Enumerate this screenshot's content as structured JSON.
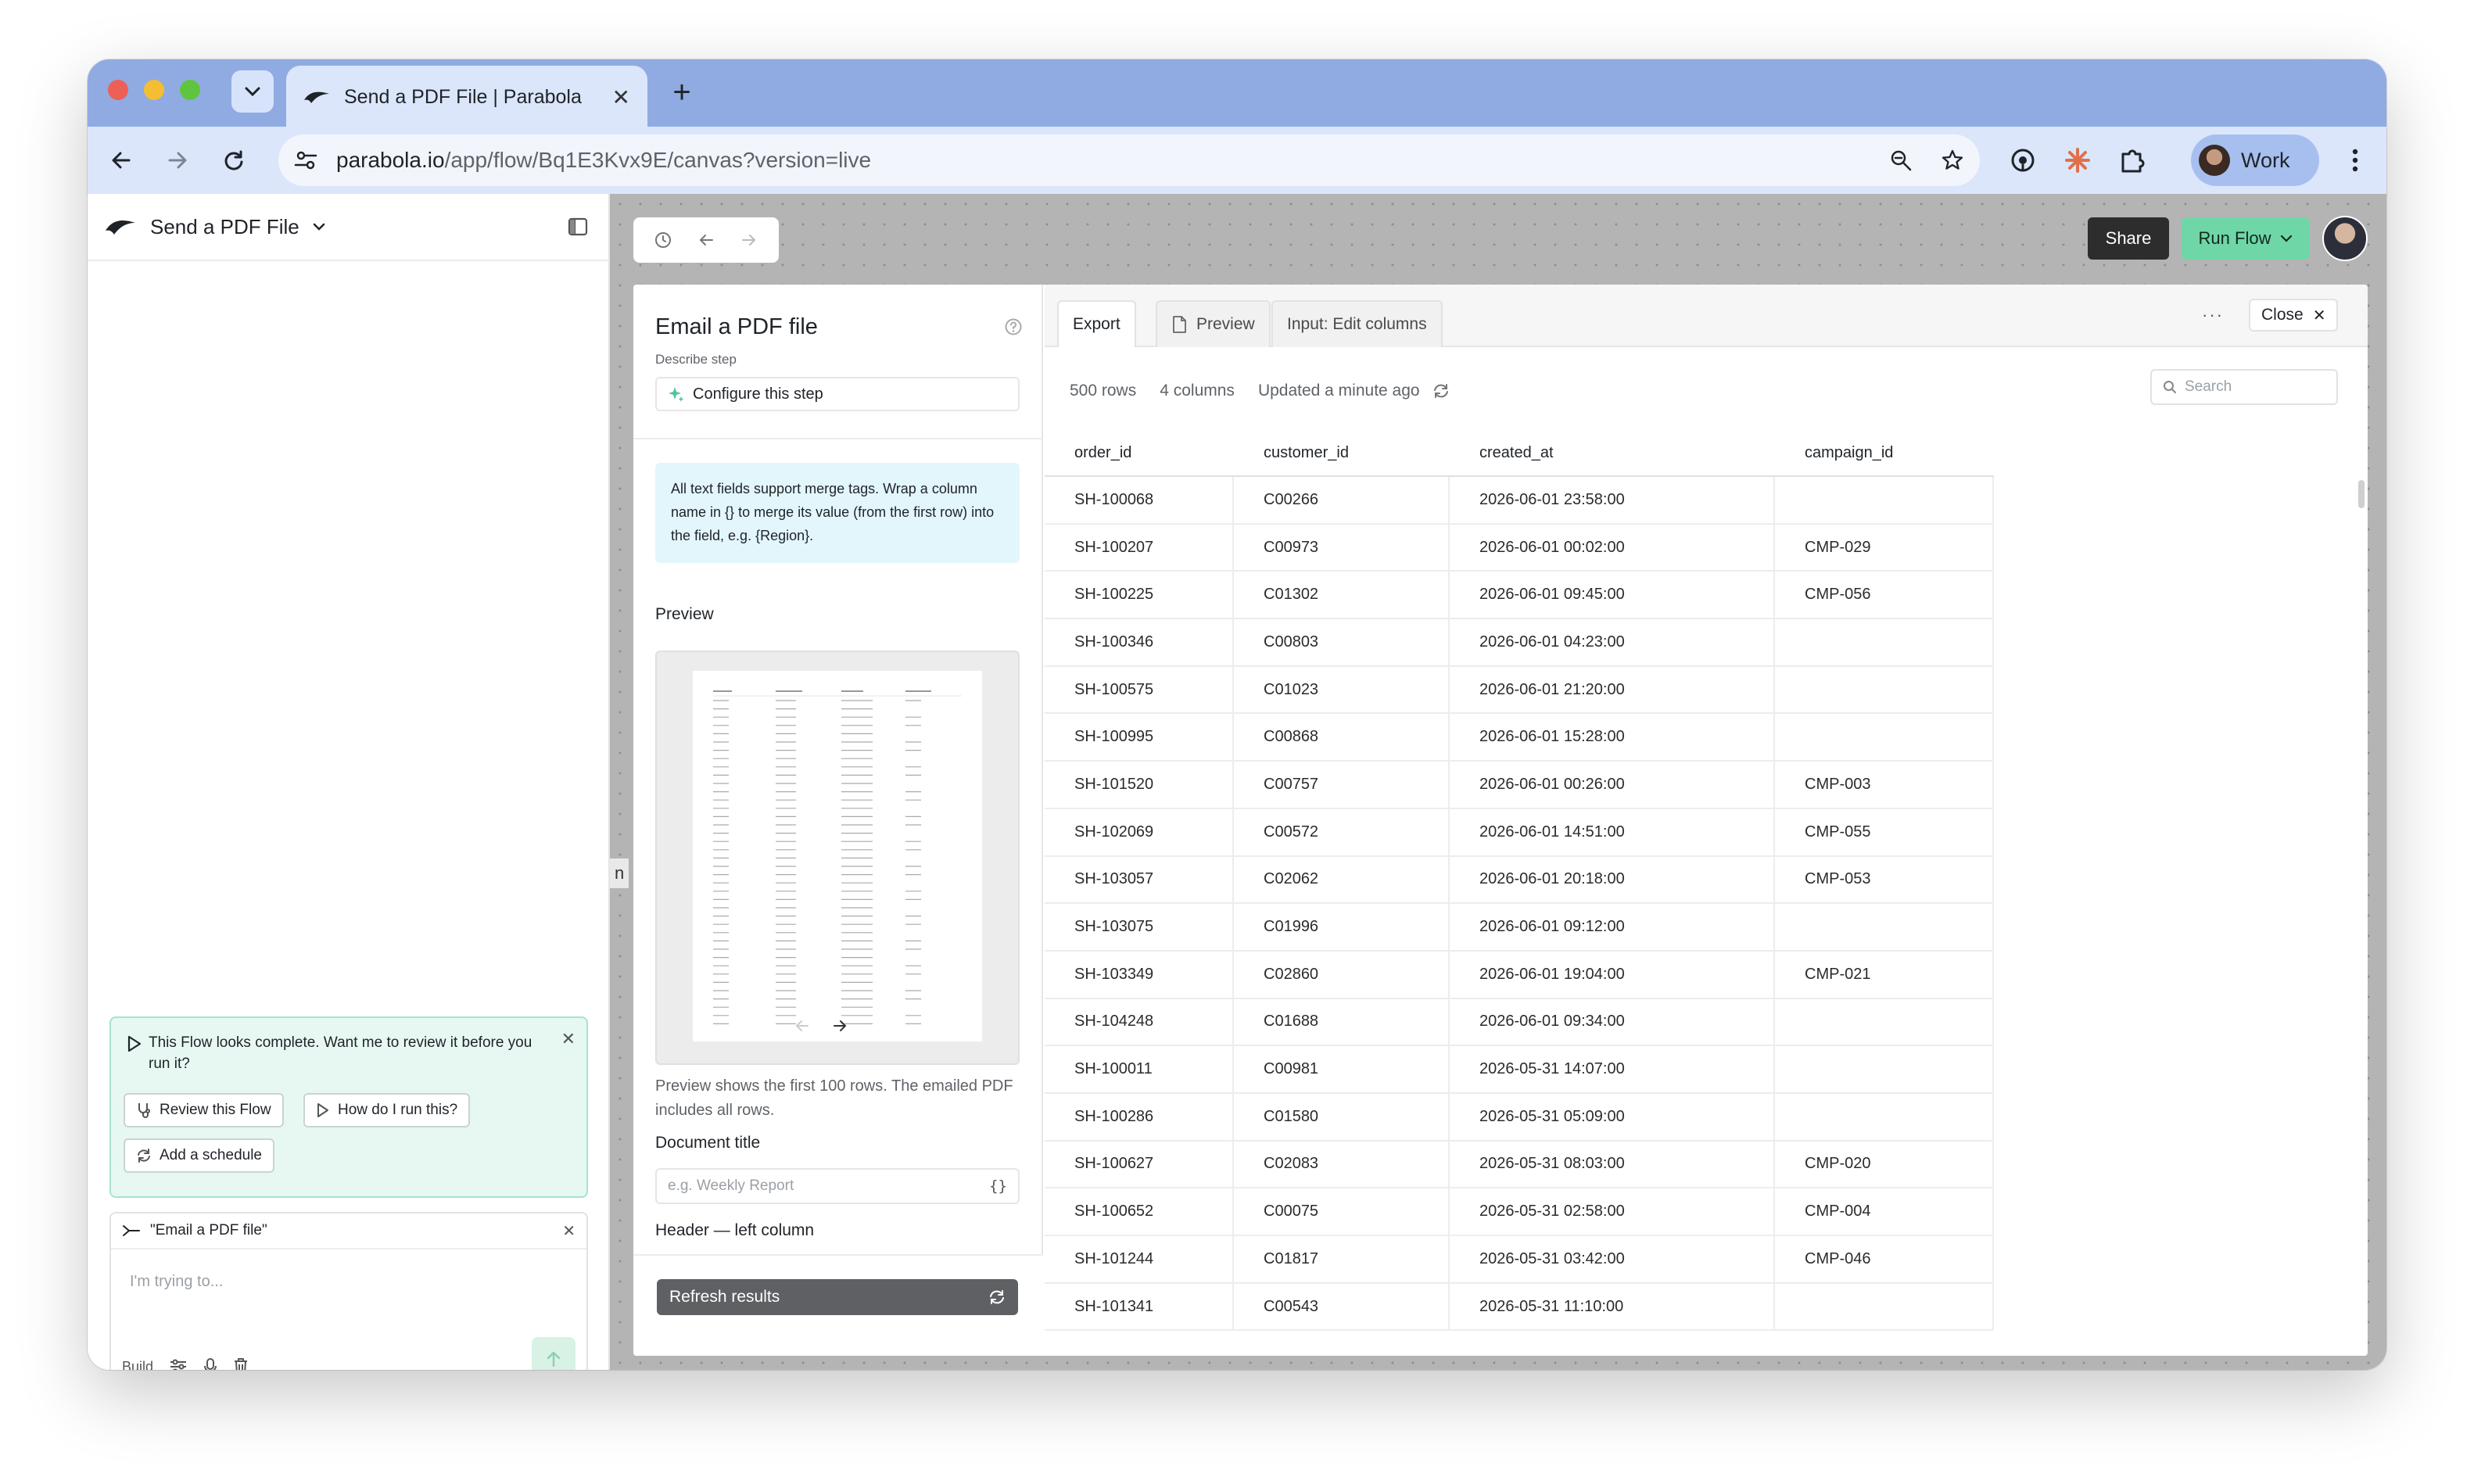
{
  "browser": {
    "tab_title": "Send a PDF File | Parabola",
    "url_host": "parabola.io",
    "url_path": "/app/flow/Bq1E3Kvx9E/canvas?version=live",
    "profile_name": "Work"
  },
  "sidebar": {
    "flow_name": "Send a PDF File",
    "ai_card": {
      "message": "This Flow looks complete. Want me to review it before you run it?",
      "buttons": [
        "Review this Flow",
        "How do I run this?",
        "Add a schedule"
      ]
    },
    "chat": {
      "context_label": "\"Email a PDF file\"",
      "placeholder": "I'm trying to...",
      "mode_label": "Build"
    }
  },
  "canvas": {
    "share_label": "Share",
    "run_label": "Run Flow",
    "side_fragment": "n"
  },
  "step": {
    "title": "Email a PDF file",
    "describe": "Describe step",
    "configure_label": "Configure this step",
    "info": "All text fields support merge tags. Wrap a column name in {} to merge its value (from the first row) into the field, e.g. {Region}.",
    "preview_label": "Preview",
    "preview_note": "Preview shows the first 100 rows. The emailed PDF includes all rows.",
    "document_title_label": "Document title",
    "document_title_placeholder": "e.g. Weekly Report",
    "header_left_label": "Header — left column",
    "refresh_label": "Refresh results"
  },
  "results": {
    "tabs": [
      "Export",
      "Preview",
      "Input: Edit columns"
    ],
    "close_label": "Close",
    "rows_count": "500 rows",
    "cols_count": "4 columns",
    "updated": "Updated a minute ago",
    "search_placeholder": "Search",
    "columns": [
      "order_id",
      "customer_id",
      "created_at",
      "campaign_id"
    ],
    "rows": [
      [
        "SH-100068",
        "C00266",
        "2026-06-01 23:58:00",
        ""
      ],
      [
        "SH-100207",
        "C00973",
        "2026-06-01 00:02:00",
        "CMP-029"
      ],
      [
        "SH-100225",
        "C01302",
        "2026-06-01 09:45:00",
        "CMP-056"
      ],
      [
        "SH-100346",
        "C00803",
        "2026-06-01 04:23:00",
        ""
      ],
      [
        "SH-100575",
        "C01023",
        "2026-06-01 21:20:00",
        ""
      ],
      [
        "SH-100995",
        "C00868",
        "2026-06-01 15:28:00",
        ""
      ],
      [
        "SH-101520",
        "C00757",
        "2026-06-01 00:26:00",
        "CMP-003"
      ],
      [
        "SH-102069",
        "C00572",
        "2026-06-01 14:51:00",
        "CMP-055"
      ],
      [
        "SH-103057",
        "C02062",
        "2026-06-01 20:18:00",
        "CMP-053"
      ],
      [
        "SH-103075",
        "C01996",
        "2026-06-01 09:12:00",
        ""
      ],
      [
        "SH-103349",
        "C02860",
        "2026-06-01 19:04:00",
        "CMP-021"
      ],
      [
        "SH-104248",
        "C01688",
        "2026-06-01 09:34:00",
        ""
      ],
      [
        "SH-100011",
        "C00981",
        "2026-05-31 14:07:00",
        ""
      ],
      [
        "SH-100286",
        "C01580",
        "2026-05-31 05:09:00",
        ""
      ],
      [
        "SH-100627",
        "C02083",
        "2026-05-31 08:03:00",
        "CMP-020"
      ],
      [
        "SH-100652",
        "C00075",
        "2026-05-31 02:58:00",
        "CMP-004"
      ],
      [
        "SH-101244",
        "C01817",
        "2026-05-31 03:42:00",
        "CMP-046"
      ],
      [
        "SH-101341",
        "C00543",
        "2026-05-31 11:10:00",
        ""
      ]
    ]
  },
  "colors": {
    "accent_green": "#6fd6a8",
    "chrome_blue": "#90abe2",
    "info_bg": "#e2f6fb"
  }
}
